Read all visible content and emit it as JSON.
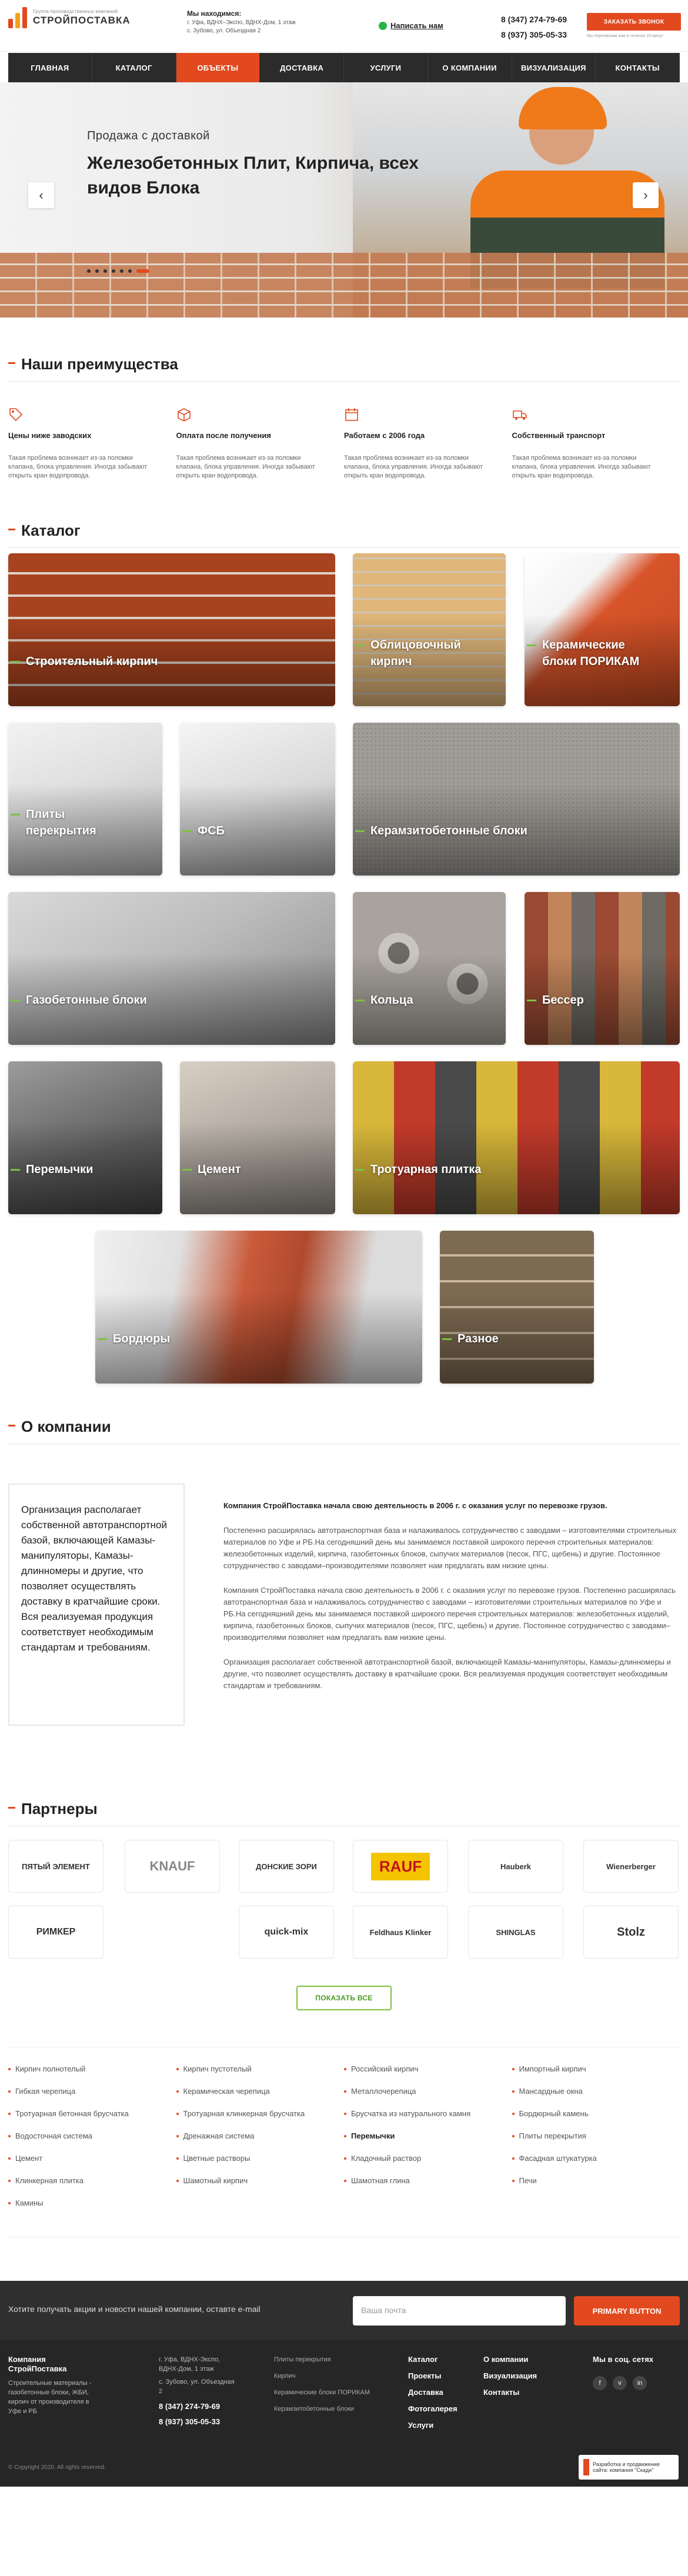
{
  "header": {
    "logo_tagline": "Группа производственных компаний",
    "logo_name": "СТРОЙПОСТАВКА",
    "address_title": "Мы находимся:",
    "address_line1": "г. Уфа, ВДНХ–Экспо, ВДНХ-Дом, 1 этаж",
    "address_line2": "с. Зубово, ул. Объездная 2",
    "whatsapp_label": "Написать нам",
    "phone1": "8 (347) 274-79-69",
    "phone2": "8 (937) 305-05-33",
    "callback_label": "ЗАКАЗАТЬ ЗВОНОК",
    "callback_note": "Мы перезвоним вам в течении 20 минут"
  },
  "nav": [
    {
      "label": "ГЛАВНАЯ",
      "active": false
    },
    {
      "label": "КАТАЛОГ",
      "active": false
    },
    {
      "label": "ОБЪЕКТЫ",
      "active": true
    },
    {
      "label": "ДОСТАВКА",
      "active": false
    },
    {
      "label": "УСЛУГИ",
      "active": false
    },
    {
      "label": "О КОМПАНИИ",
      "active": false
    },
    {
      "label": "ВИЗУАЛИЗАЦИЯ",
      "active": false
    },
    {
      "label": "КОНТАКТЫ",
      "active": false
    }
  ],
  "hero": {
    "subtitle": "Продажа с доставкой",
    "title": "Железобетонных Плит, Кирпича, всех видов Блока",
    "prev_icon": "‹",
    "next_icon": "›",
    "slides_count": 7,
    "active_slide": 6
  },
  "advantages": {
    "heading": "Наши преимущества",
    "items": [
      {
        "icon": "price-tag-icon",
        "title": "Цены ниже заводских",
        "text": "Такая проблема возникает из-за поломки клапана, блока управления. Иногда забывают открыть кран водопровода."
      },
      {
        "icon": "box-icon",
        "title": "Оплата после получения",
        "text": "Такая проблема возникает из-за поломки клапана, блока управления. Иногда забывают открыть кран водопровода."
      },
      {
        "icon": "calendar-icon",
        "title": "Работаем с 2006 года",
        "text": "Такая проблема возникает из-за поломки клапана, блока управления. Иногда забывают открыть кран водопровода."
      },
      {
        "icon": "truck-icon",
        "title": "Собственный транспорт",
        "text": "Такая проблема возникает из-за поломки клапана, блока управления. Иногда забывают открыть кран водопровода."
      }
    ]
  },
  "catalog": {
    "heading": "Каталог",
    "items": [
      {
        "label": "Строительный кирпич"
      },
      {
        "label": "Облицовочный кирпич"
      },
      {
        "label": "Керамические блоки ПОРИКАМ"
      },
      {
        "label": "Плиты перекрытия"
      },
      {
        "label": "ФСБ"
      },
      {
        "label": "Керамзитобетонные блоки"
      },
      {
        "label": "Газобетонные блоки"
      },
      {
        "label": "Кольца"
      },
      {
        "label": "Бессер"
      },
      {
        "label": "Перемычки"
      },
      {
        "label": "Цемент"
      },
      {
        "label": "Тротуарная плитка"
      },
      {
        "label": "Бордюры"
      },
      {
        "label": "Разное"
      }
    ]
  },
  "about": {
    "heading": "О компании",
    "box_text": "Организация располагает собственной автотранспортной базой, включающей Камазы-манипуляторы, Камазы-длинномеры и другие, что позволяет осуществлять доставку в кратчайшие сроки. Вся реализуемая продукция соответствует необходимым стандартам и требованиям.",
    "lead": "Компания СтройПоставка начала свою деятельность в 2006 г. с оказания услуг по перевозке грузов.",
    "p1": "Постепенно расширялась автотранспортная база и налаживалось сотрудничество с заводами – изготовителями строительных материалов по Уфе и РБ.На сегодняшний день мы занимаемся поставкой широкого перечня строительных материалов: железобетонных изделий, кирпича, газобетонных блоков, сыпучих материалов (песок, ПГС, щебень) и другие. Постоянное сотрудничество с заводами–производителями позволяет нам предлагать вам низкие цены.",
    "p2": "Компания СтройПоставка начала свою деятельность в 2006 г. с оказания услуг по перевозке грузов. Постепенно расширялась автотранспортная база и налаживалось сотрудничество с заводами – изготовителями строительных материалов по Уфе и РБ.На сегодняшний день мы занимаемся поставкой широкого перечня строительных материалов: железобетонных изделий, кирпича, газобетонных блоков, сыпучих материалов (песок, ПГС, щебень) и другие. Постоянное сотрудничество с заводами–производителями позволяет нам предлагать вам низкие цены.",
    "p3": "Организация располагает собственной автотранспортной базой, включающей Камазы-манипуляторы, Камазы-длинномеры и другие, что позволяет осуществлять доставку в кратчайшие сроки. Вся реализуемая продукция соответствует необходимым стандартам и требованиям."
  },
  "partners": {
    "heading": "Партнеры",
    "items": [
      "ПЯТЫЙ ЭЛЕМЕНТ",
      "KNAUF",
      "ДОНСКИЕ ЗОРИ",
      "RAUF",
      "Hauberk",
      "Wienerberger",
      "РИМКЕР",
      "quick-mix",
      "Feldhaus Klinker",
      "SHINGLAS",
      "Stolz"
    ],
    "show_all": "ПОКАЗАТЬ ВСЕ"
  },
  "links": {
    "col1": [
      "Кирпич полнотелый",
      "Гибкая черепица",
      "Тротуарная бетонная брусчатка",
      "Водосточная система",
      "Цемент",
      "Клинкерная плитка",
      "Камины"
    ],
    "col2": [
      "Кирпич пустотелый",
      "Керамическая черепица",
      "Тротуарная клинкерная брусчатка",
      "Дренажная система",
      "Цветные растворы",
      "Шамотный кирпич"
    ],
    "col3": [
      "Российский кирпич",
      "Металлочерепица",
      "Брусчатка из натурального камня",
      "Перемычки",
      "Кладочный раствор",
      "Шамотная глина"
    ],
    "col4": [
      "Импортный кирпич",
      "Мансардные окна",
      "Бордюрный камень",
      "Плиты перекрытия",
      "Фасадная штукатурка",
      "Печи"
    ]
  },
  "newsletter": {
    "text": "Хотите получать акции и новости нашей компании, оставте e-mail",
    "placeholder": "Ваша почта",
    "button": "PRIMARY BUTTON"
  },
  "footer": {
    "company": "Компания СтройПоставка",
    "company_desc": "Строительные материалы - газобетонные блоки, ЖБИ, кирпич от производителя в Уфе и РБ",
    "addr": "г. Уфа, ВДНХ-Экспо, ВДНХ-Дом, 1 этаж",
    "addr2": "с. Зубово, ул. Объездная 2",
    "phone1": "8 (347) 274-79-69",
    "phone2": "8 (937) 305-05-33",
    "cat_links": [
      "Плиты перекрытия",
      "Кирпич",
      "Керамические блоки ПОРИКАМ",
      "Керамзитобетонные блоки"
    ],
    "nav1": [
      "Каталог",
      "Проекты",
      "Доставка",
      "Фотогалерея",
      "Услуги"
    ],
    "nav2": [
      "О компании",
      "Визуализация",
      "Контакты"
    ],
    "social_title": "Мы в соц. сетях",
    "social": [
      "f",
      "v",
      "in"
    ],
    "copyright": "© Copyright 2020. All rights reserved.",
    "developer": "Разработка и продвижение сайта: компания \"Скади\""
  }
}
